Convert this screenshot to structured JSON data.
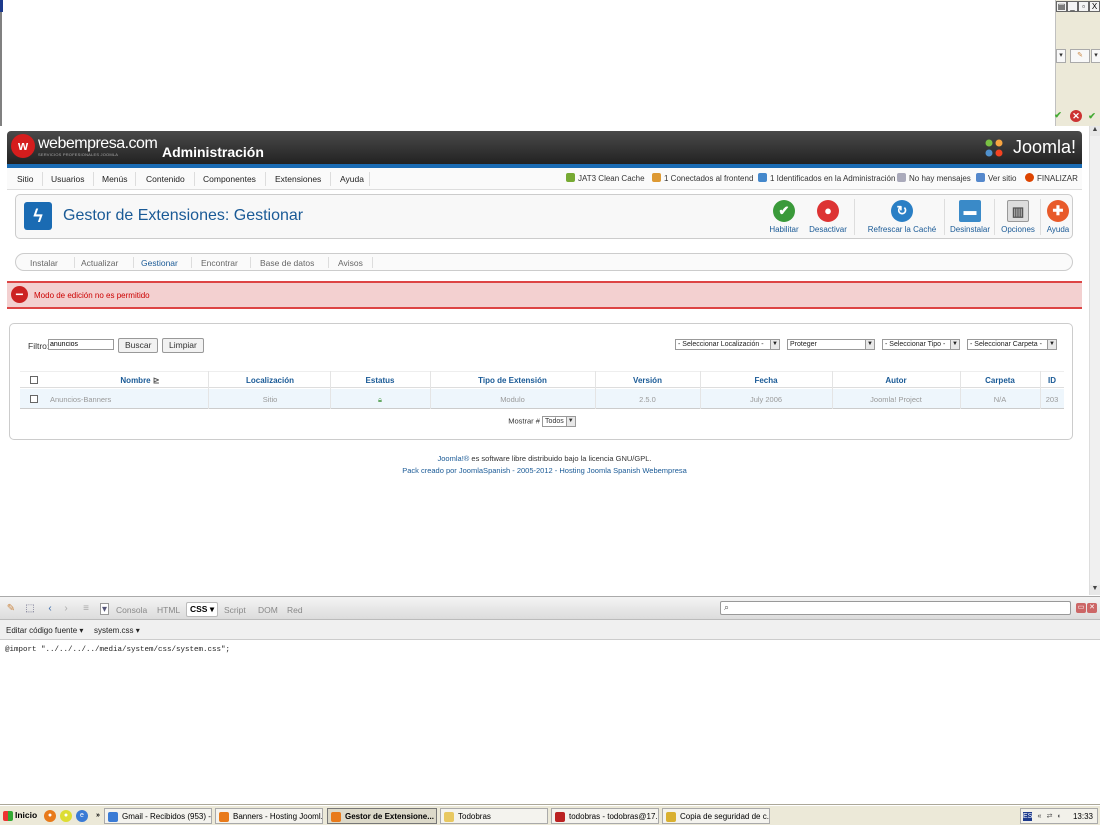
{
  "window": {
    "min_label": "_",
    "restore_label": "▫",
    "close_label": "X",
    "extra_label": "▤"
  },
  "header": {
    "logo_letter": "w",
    "brand": "webempresa.com",
    "brand_sub": "SERVICIOS PROFESIONALES JOOMLA",
    "title": "Administración",
    "joomla_logo": "Joomla!"
  },
  "menu": {
    "items": [
      "Sitio",
      "Usuarios",
      "Menús",
      "Contenido",
      "Componentes",
      "Extensiones",
      "Ayuda"
    ]
  },
  "status": {
    "cache": "JAT3 Clean Cache",
    "frontend": "1 Conectados al frontend",
    "admin": "1 Identificados en la Administración",
    "messages": "No hay mensajes",
    "view_site": "Ver sitio",
    "logout": "FINALIZAR"
  },
  "page": {
    "title": "Gestor de Extensiones: Gestionar"
  },
  "toolbar": {
    "enable": "Habilitar",
    "disable": "Desactivar",
    "refresh": "Refrescar la Caché",
    "uninstall": "Desinstalar",
    "options": "Opciones",
    "help": "Ayuda"
  },
  "subnav": {
    "items": [
      "Instalar",
      "Actualizar",
      "Gestionar",
      "Encontrar",
      "Base de datos",
      "Avisos"
    ],
    "active": "Gestionar"
  },
  "error": {
    "message": "Modo de edición no es permitido"
  },
  "filter": {
    "label": "Filtro:",
    "value": "anuncios",
    "search_btn": "Buscar",
    "clear_btn": "Limpiar",
    "location": "- Seleccionar Localización -",
    "protect": "Proteger",
    "type": "- Seleccionar Tipo -",
    "folder": "- Seleccionar Carpeta -"
  },
  "table": {
    "headers": [
      "Nombre",
      "Localización",
      "Estatus",
      "Tipo de Extensión",
      "Versión",
      "Fecha",
      "Autor",
      "Carpeta",
      "ID"
    ],
    "rows": [
      {
        "name": "Anuncios-Banners",
        "location": "Sitio",
        "status": "locked",
        "type": "Modulo",
        "version": "2.5.0",
        "date": "July 2006",
        "author": "Joomla! Project",
        "folder": "N/A",
        "id": "203"
      }
    ]
  },
  "pager": {
    "label": "Mostrar #",
    "value": "Todos"
  },
  "footer": {
    "line1_link": "Joomla!®",
    "line1_rest": " es software libre distribuido bajo la licencia GNU/GPL.",
    "line2": "Pack creado por JoomlaSpanish - 2005-2012 - Hosting Joomla Spanish Webempresa"
  },
  "firebug": {
    "tabs": [
      "Consola",
      "HTML",
      "CSS",
      "Script",
      "DOM",
      "Red"
    ],
    "active_tab": "CSS",
    "edit_label": "Editar código fuente",
    "file": "system.css",
    "code": "@import \"../../../../media/system/css/system.css\";"
  },
  "taskbar": {
    "start": "Inicio",
    "more": "»",
    "tasks": [
      "Gmail - Recibidos (953) - ...",
      "Banners - Hosting Jooml...",
      "Gestor de Extensione...",
      "Todobras",
      "todobras - todobras@17...",
      "Copia de seguridad de c..."
    ],
    "active_task": "Gestor de Extensione...",
    "tray_lang": "ES",
    "tray_more": "«",
    "clock": "13:33"
  },
  "colors": {
    "accent": "#1a5a96",
    "error_bg": "#f3d0d0",
    "error_text": "#cc0000",
    "header_bg": "#2a2a2a",
    "row_bg": "#eef6fc"
  }
}
